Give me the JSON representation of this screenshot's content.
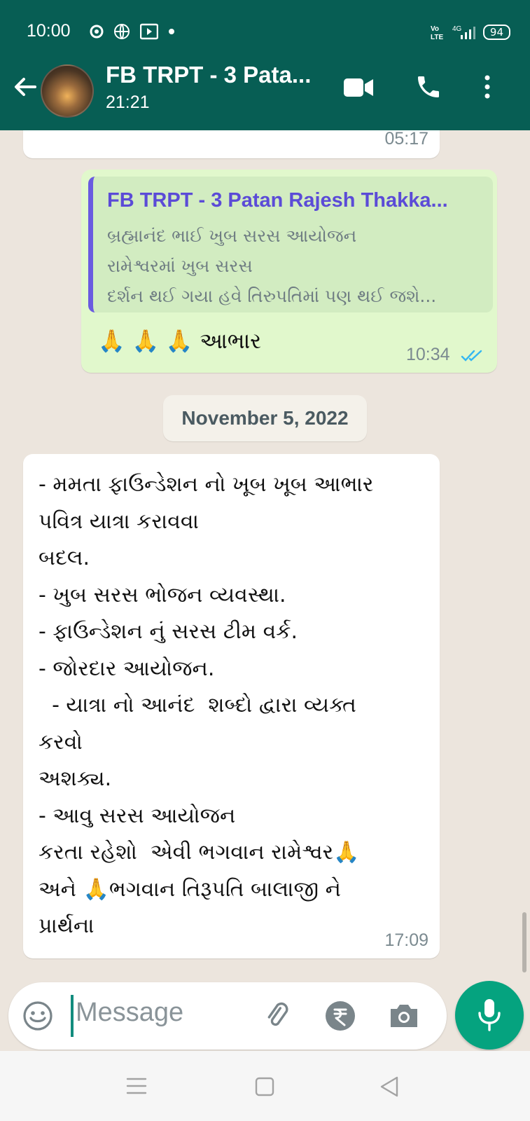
{
  "status_bar": {
    "time": "10:00",
    "battery": "94",
    "network": "4G",
    "volte": "VoLTE"
  },
  "header": {
    "title": "FB TRPT - 3 Pata...",
    "subtitle": "21:21"
  },
  "messages": {
    "partial_top": {
      "time": "05:17"
    },
    "reply": {
      "quote_author": "FB TRPT - 3 Patan Rajesh Thakka...",
      "quote_lines": [
        "બ્રહ્માનંદ ભાઈ ખુબ સરસ આયોજન",
        "રામેશ્વરમાં ખુબ સરસ",
        "દર્શન થઈ ગયા હવે તિરુપતિમાં પણ થઈ જશે..."
      ],
      "text": "🙏 🙏 🙏 આભાર",
      "time": "10:34"
    },
    "date_divider": "November 5, 2022",
    "long_message": {
      "lines": [
        "- મમતા ફાઉન્ડેશન નો ખૂબ ખૂબ આભાર",
        "પવિત્ર યાત્રા કરાવવા",
        "બદલ.",
        "- ખુબ સરસ ભોજન વ્યવસ્થા.",
        "- ફાઉન્ડેશન નું સરસ ટીમ વર્ક.",
        "- જોરદાર આયોજન.",
        "  - યાત્રા નો આનંદ  શબ્દો દ્વારા વ્યક્ત",
        "કરવો",
        "અશક્ય.",
        "- આવુ સરસ આયોજન",
        "કરતા રહેશો  એવી ભગવાન રામેશ્વર🙏",
        "અને 🙏ભગવાન તિરૂપતિ બાલાજી ને",
        "પ્રાર્થના"
      ],
      "time": "17:09"
    }
  },
  "input": {
    "placeholder": "Message"
  },
  "colors": {
    "header": "#075e54",
    "outgoing": "#e1f8cc",
    "incoming": "#ffffff",
    "mic": "#05a37f",
    "chat_bg": "#ece5dd"
  },
  "icons": [
    "back-arrow-icon",
    "video-call-icon",
    "voice-call-icon",
    "more-options-icon",
    "emoji-icon",
    "attach-icon",
    "rupee-icon",
    "camera-icon",
    "mic-icon",
    "double-check-icon"
  ]
}
